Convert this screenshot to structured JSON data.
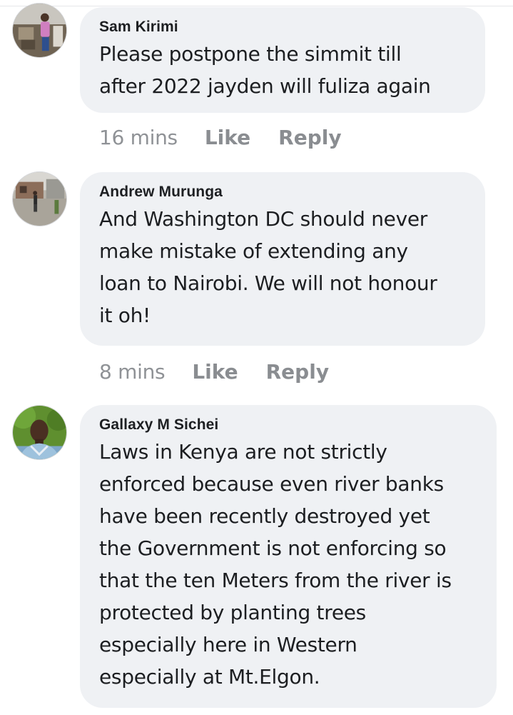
{
  "comments": [
    {
      "author": "Sam Kirimi",
      "lines": [
        "Please postpone the simmit till",
        "after  2022 jayden will fuliza again"
      ],
      "time": "16 mins",
      "like": "Like",
      "reply": "Reply"
    },
    {
      "author": "Andrew Murunga",
      "lines": [
        "And Washington DC should never",
        "make mistake of extending any",
        "loan to Nairobi. We will not honour",
        "it oh!"
      ],
      "time": "8 mins",
      "like": "Like",
      "reply": "Reply"
    },
    {
      "author": "Gallaxy M Sichei",
      "lines": [
        "Laws in Kenya are not strictly",
        "enforced because even river banks",
        "have been recently destroyed yet",
        "the Government is not enforcing so",
        "that the ten Meters from the river is",
        "protected by planting trees",
        "especially here in Western",
        "especially at Mt.Elgon."
      ]
    }
  ],
  "colors": {
    "bubble": "#eff1f4",
    "text": "#1c1e21",
    "meta": "#8a8d91"
  }
}
